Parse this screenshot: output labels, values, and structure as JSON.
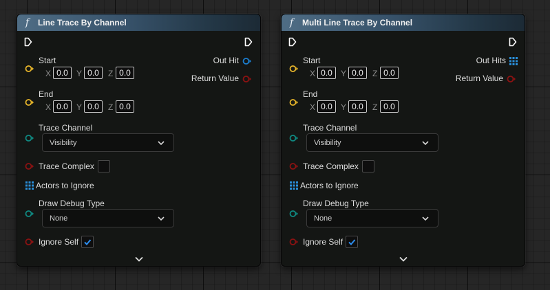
{
  "nodes": [
    {
      "title": "Line Trace By Channel",
      "title_icon": "function-f-icon",
      "inputs": {
        "start": {
          "label": "Start",
          "x": "0.0",
          "y": "0.0",
          "z": "0.0"
        },
        "end": {
          "label": "End",
          "x": "0.0",
          "y": "0.0",
          "z": "0.0"
        },
        "trace_channel": {
          "label": "Trace Channel",
          "value": "Visibility"
        },
        "trace_complex": {
          "label": "Trace Complex",
          "checked": false
        },
        "actors_to_ignore": {
          "label": "Actors to Ignore"
        },
        "draw_debug_type": {
          "label": "Draw Debug Type",
          "value": "None"
        },
        "ignore_self": {
          "label": "Ignore Self",
          "checked": true
        }
      },
      "outputs": {
        "hit": {
          "label": "Out Hit"
        },
        "return_value": {
          "label": "Return Value"
        }
      }
    },
    {
      "title": "Multi Line Trace By Channel",
      "title_icon": "function-f-icon",
      "inputs": {
        "start": {
          "label": "Start",
          "x": "0.0",
          "y": "0.0",
          "z": "0.0"
        },
        "end": {
          "label": "End",
          "x": "0.0",
          "y": "0.0",
          "z": "0.0"
        },
        "trace_channel": {
          "label": "Trace Channel",
          "value": "Visibility"
        },
        "trace_complex": {
          "label": "Trace Complex",
          "checked": false
        },
        "actors_to_ignore": {
          "label": "Actors to Ignore"
        },
        "draw_debug_type": {
          "label": "Draw Debug Type",
          "value": "None"
        },
        "ignore_self": {
          "label": "Ignore Self",
          "checked": true
        }
      },
      "outputs": {
        "hit": {
          "label": "Out Hits"
        },
        "return_value": {
          "label": "Return Value"
        }
      }
    }
  ],
  "axis_labels": {
    "x": "X",
    "y": "Y",
    "z": "Z"
  },
  "f_glyph": "f",
  "colors": {
    "vector_pin": "#e8b62a",
    "enum_pin": "#0f8a82",
    "bool_pin": "#8c1212",
    "struct_pin": "#1b7fd1",
    "array_pin": "#2a8ed8",
    "exec_pin": "#ffffff",
    "header_start": "#4f6d85",
    "header_end": "#1c2a35",
    "node_bg": "#141614"
  }
}
